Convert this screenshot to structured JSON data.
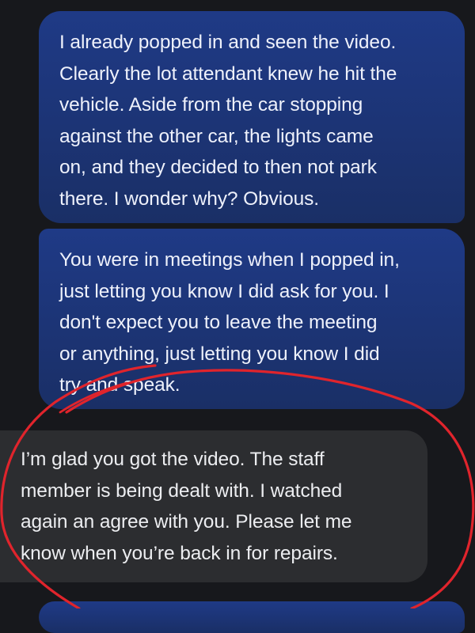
{
  "messages": [
    {
      "direction": "sent",
      "lines": [
        "I already popped in and seen the video.",
        "Clearly the lot attendant knew he hit the",
        "vehicle. Aside from the car stopping",
        "against the other car, the lights came",
        "on, and they decided to then not park",
        "there.  I wonder why? Obvious."
      ]
    },
    {
      "direction": "sent",
      "lines": [
        "You were in meetings when I popped in,",
        "just letting you know I did ask for you. I",
        "don't expect you to leave the meeting",
        "or anything, just letting you know I did",
        "try and speak."
      ]
    },
    {
      "direction": "received",
      "lines": [
        "I’m glad you got the video.  The staff",
        "member is being dealt with.  I watched",
        "again an agree with you.  Please let me",
        "know when you’re back in for repairs."
      ]
    },
    {
      "direction": "sent",
      "lines": []
    }
  ],
  "colors": {
    "background": "#17181c",
    "sent_bubble": "#1c3475",
    "received_bubble": "#2c2d30",
    "annotation": "#e0242c"
  }
}
